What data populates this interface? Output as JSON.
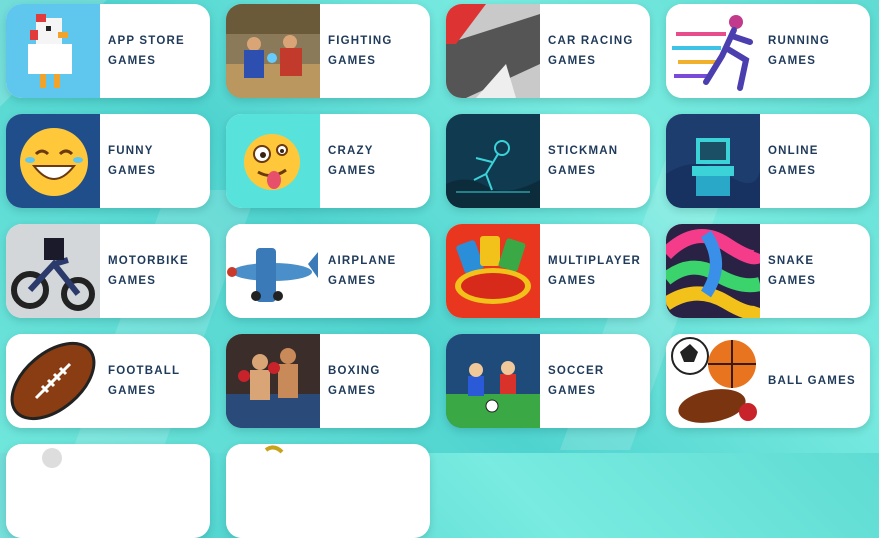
{
  "cards": [
    {
      "l1": "APP STORE",
      "l2": "GAMES",
      "icon": "crossy-chicken-icon"
    },
    {
      "l1": "FIGHTING",
      "l2": "GAMES",
      "icon": "street-fighter-icon"
    },
    {
      "l1": "CAR RACING",
      "l2": "GAMES",
      "icon": "race-car-icon"
    },
    {
      "l1": "RUNNING",
      "l2": "GAMES",
      "icon": "runner-icon"
    },
    {
      "l1": "FUNNY",
      "l2": "GAMES",
      "icon": "laughing-emoji-icon"
    },
    {
      "l1": "CRAZY",
      "l2": "GAMES",
      "icon": "crazy-emoji-icon"
    },
    {
      "l1": "STICKMAN",
      "l2": "GAMES",
      "icon": "stickman-icon"
    },
    {
      "l1": "ONLINE",
      "l2": "GAMES",
      "icon": "arcade-machine-icon"
    },
    {
      "l1": "MOTORBIKE",
      "l2": "GAMES",
      "icon": "motorbike-icon"
    },
    {
      "l1": "AIRPLANE",
      "l2": "GAMES",
      "icon": "airplane-icon"
    },
    {
      "l1": "MULTIPLAYER",
      "l2": "GAMES",
      "icon": "uno-cards-icon"
    },
    {
      "l1": "SNAKE",
      "l2": "GAMES",
      "icon": "snake-icon"
    },
    {
      "l1": "FOOTBALL",
      "l2": "GAMES",
      "icon": "football-icon"
    },
    {
      "l1": "BOXING",
      "l2": "GAMES",
      "icon": "boxing-icon"
    },
    {
      "l1": "SOCCER",
      "l2": "GAMES",
      "icon": "soccer-icon"
    },
    {
      "l1": "BALL GAMES",
      "l2": "",
      "icon": "balls-icon"
    }
  ]
}
